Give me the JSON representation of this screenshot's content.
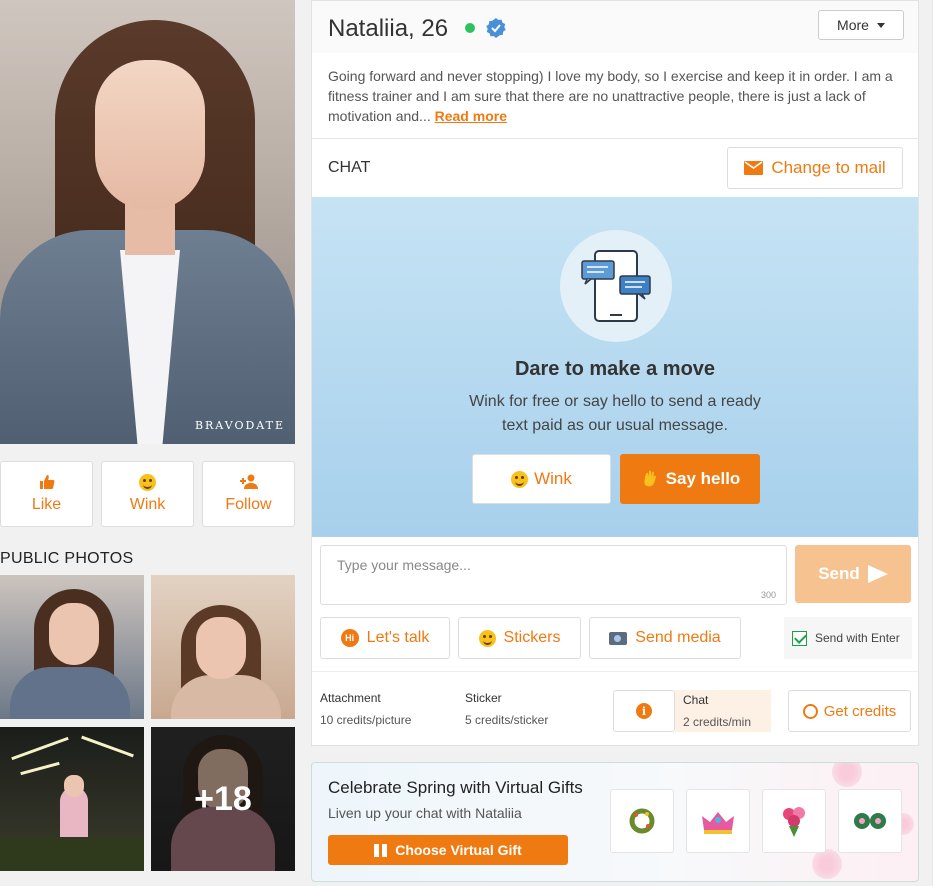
{
  "profile": {
    "name": "Nataliia, 26",
    "watermark": "BRAVODATE",
    "more_label": "More",
    "bio": "Going forward and never stopping) I love my body, so I exercise and keep it in order. I am a fitness trainer and I am sure that there are no unattractive people, there is just a lack of motivation and...",
    "read_more": "Read more",
    "status_color": "#30c15f"
  },
  "actions": {
    "like": "Like",
    "wink": "Wink",
    "follow": "Follow"
  },
  "photos": {
    "title": "PUBLIC PHOTOS",
    "more_count": "+18"
  },
  "chat": {
    "label": "CHAT",
    "change_to_mail": "Change to mail",
    "promo_title": "Dare to make a move",
    "promo_text": "Wink for free or say hello to send a ready text paid as our usual message.",
    "wink_label": "Wink",
    "say_hello_label": "Say hello",
    "placeholder": "Type your message...",
    "char_limit": "300",
    "send_label": "Send",
    "lets_talk": "Let's talk",
    "stickers": "Stickers",
    "send_media": "Send media",
    "send_with_enter": "Send with Enter",
    "send_with_enter_checked": true
  },
  "costs": {
    "attachment_label": "Attachment",
    "attachment_value": "10 credits/picture",
    "sticker_label": "Sticker",
    "sticker_value": "5 credits/sticker",
    "chat_label": "Chat",
    "chat_value": "2 credits/min",
    "get_credits": "Get credits"
  },
  "gift": {
    "title": "Celebrate Spring with Virtual Gifts",
    "subtitle": "Liven up your chat with Nataliia",
    "button": "Choose Virtual Gift",
    "items": [
      "wreath-gift",
      "crown-gift",
      "bouquet-gift",
      "flowers-gift"
    ]
  },
  "colors": {
    "accent": "#f07a12",
    "send_disabled": "#f6c28f",
    "promo_bg": "#b7d9ef",
    "verified": "#4a90d9"
  }
}
